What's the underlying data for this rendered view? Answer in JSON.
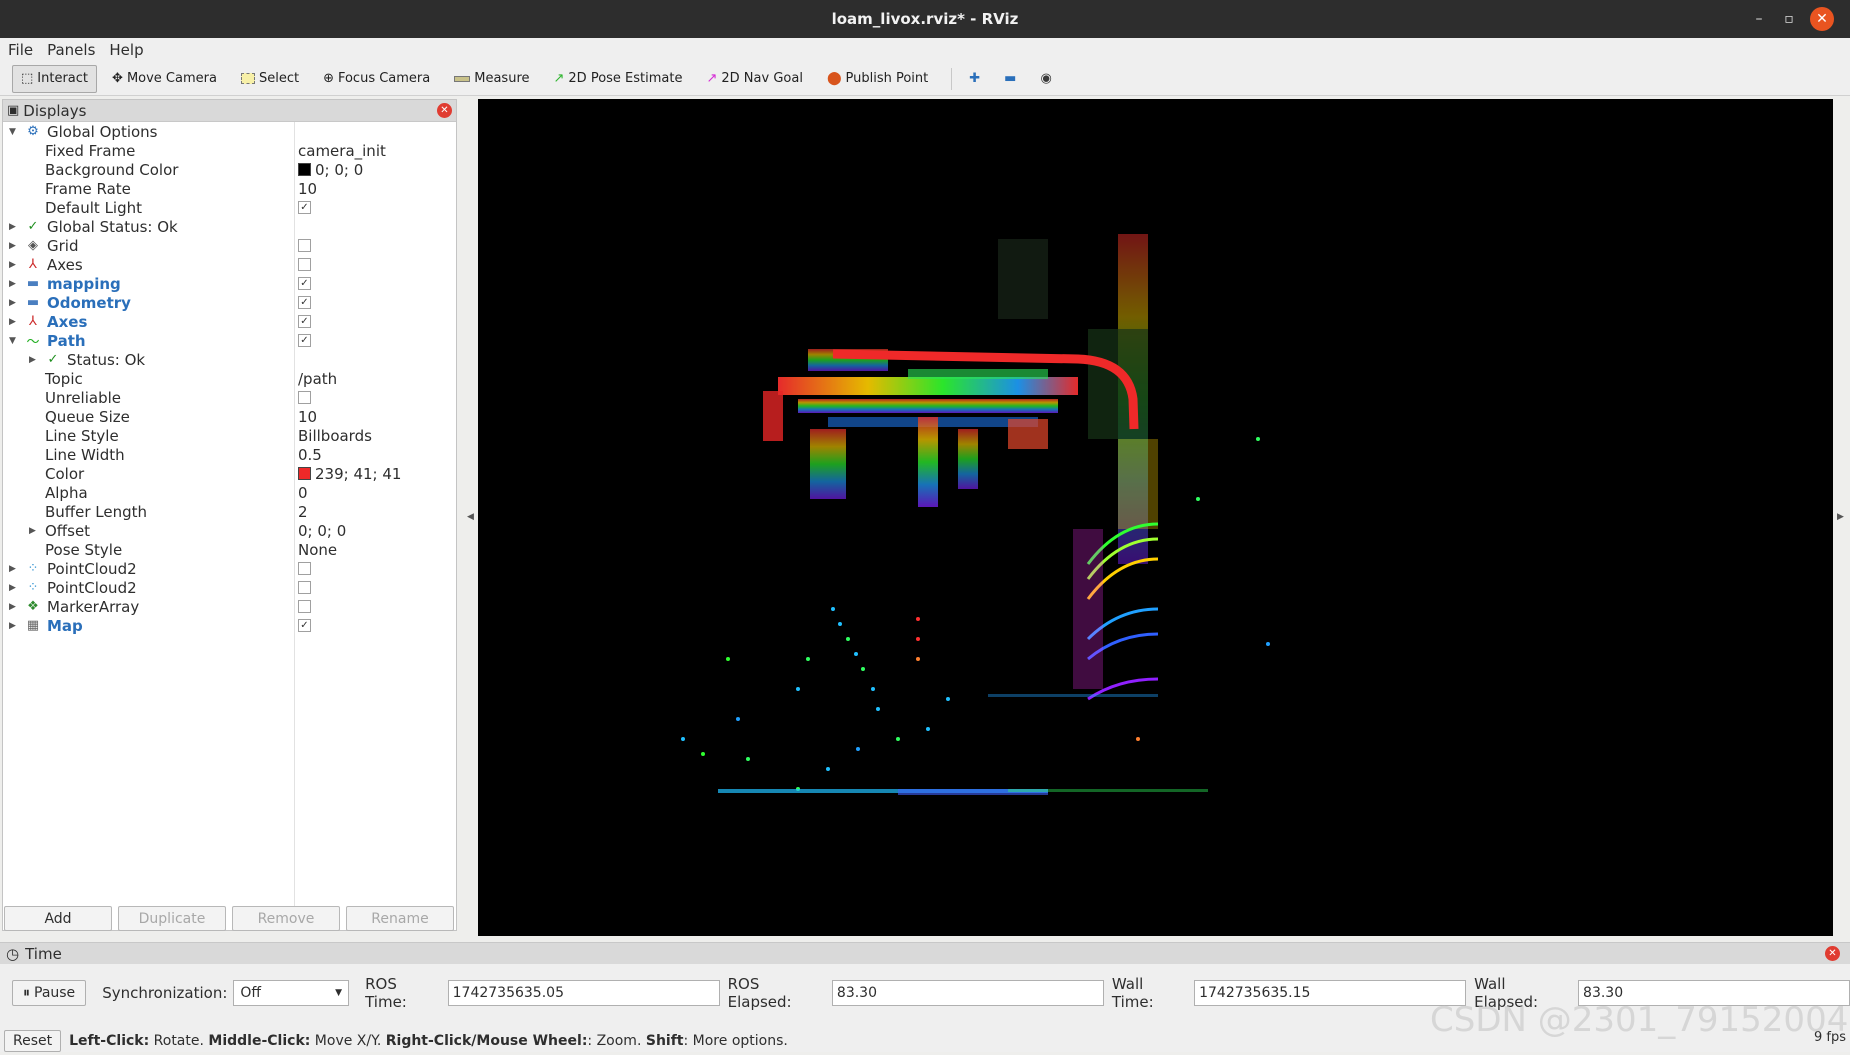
{
  "window": {
    "title": "loam_livox.rviz* - RViz",
    "minimize": "–",
    "maximize": "▫",
    "close": "✕"
  },
  "menu": {
    "file": "File",
    "panels": "Panels",
    "help": "Help"
  },
  "toolbar": {
    "interact": "Interact",
    "move_camera": "Move Camera",
    "select": "Select",
    "focus_camera": "Focus Camera",
    "measure": "Measure",
    "pose_estimate": "2D Pose Estimate",
    "nav_goal": "2D Nav Goal",
    "publish_point": "Publish Point"
  },
  "displays": {
    "title": "Displays",
    "global_options": "Global Options",
    "fixed_frame_label": "Fixed Frame",
    "fixed_frame_value": "camera_init",
    "background_color_label": "Background Color",
    "background_color_value": "0; 0; 0",
    "background_color_swatch": "#000000",
    "frame_rate_label": "Frame Rate",
    "frame_rate_value": "10",
    "default_light_label": "Default Light",
    "global_status": "Global Status: Ok",
    "grid": "Grid",
    "axes": "Axes",
    "mapping": "mapping",
    "odometry": "Odometry",
    "axes2": "Axes",
    "path": "Path",
    "status_ok": "Status: Ok",
    "topic_label": "Topic",
    "topic_value": "/path",
    "unreliable_label": "Unreliable",
    "queue_size_label": "Queue Size",
    "queue_size_value": "10",
    "line_style_label": "Line Style",
    "line_style_value": "Billboards",
    "line_width_label": "Line Width",
    "line_width_value": "0.5",
    "color_label": "Color",
    "color_value": "239; 41; 41",
    "color_swatch": "#ef2929",
    "alpha_label": "Alpha",
    "alpha_value": "0",
    "buffer_length_label": "Buffer Length",
    "buffer_length_value": "2",
    "offset_label": "Offset",
    "offset_value": "0; 0; 0",
    "pose_style_label": "Pose Style",
    "pose_style_value": "None",
    "pointcloud2_a": "PointCloud2",
    "pointcloud2_b": "PointCloud2",
    "marker_array": "MarkerArray",
    "map": "Map",
    "buttons": {
      "add": "Add",
      "duplicate": "Duplicate",
      "remove": "Remove",
      "rename": "Rename"
    }
  },
  "time": {
    "title": "Time",
    "pause": "Pause",
    "sync_label": "Synchronization:",
    "sync_value": "Off",
    "ros_time_label": "ROS Time:",
    "ros_time_value": "1742735635.05",
    "ros_elapsed_label": "ROS Elapsed:",
    "ros_elapsed_value": "83.30",
    "wall_time_label": "Wall Time:",
    "wall_time_value": "1742735635.15",
    "wall_elapsed_label": "Wall Elapsed:",
    "wall_elapsed_value": "83.30"
  },
  "status": {
    "reset": "Reset",
    "left_click": "Left-Click:",
    "rotate": " Rotate. ",
    "middle_click": "Middle-Click:",
    "move": " Move X/Y. ",
    "right_click": "Right-Click/Mouse Wheel:",
    "zoom": ": Zoom. ",
    "shift": "Shift",
    "more": ": More options.",
    "fps": "9 fps"
  },
  "watermark": "CSDN @2301_79152004"
}
